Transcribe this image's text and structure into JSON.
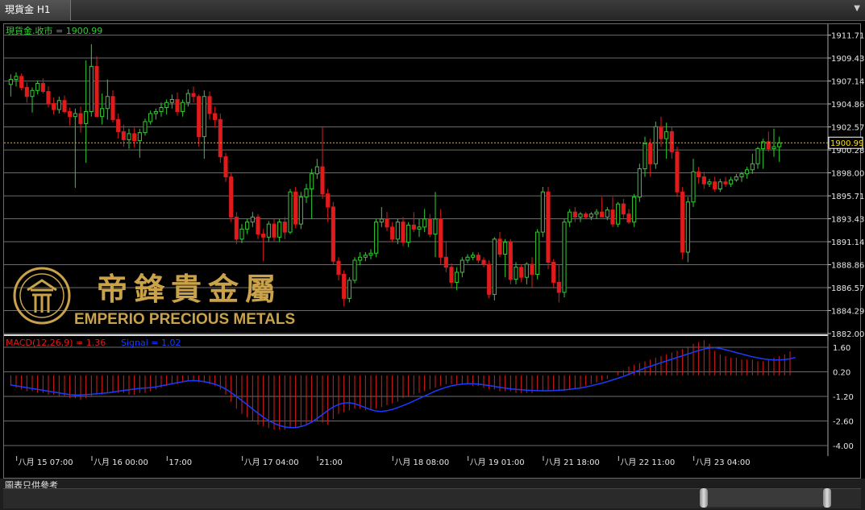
{
  "window": {
    "tab_label": "現貨金 H1",
    "menu_icon": "dropdown-triangle-icon"
  },
  "footer": {
    "label": "圖表只供參考"
  },
  "colors": {
    "up": "#33cc33",
    "down": "#e01b1b",
    "grid": "#6b6b6b",
    "price_line": "#ffaa00",
    "macd_hist": "#e01b1b",
    "signal": "#1a3cff",
    "title_text": "#33cc33",
    "macd_text": "#e01b1b",
    "logo": "#c9a24a"
  },
  "logo": {
    "chinese": "帝鋒貴金屬",
    "english": "EMPERIO PRECIOUS METALS",
    "emblem": "emperio-seal-icon"
  },
  "chart_data": [
    {
      "type": "candlestick",
      "title": "現貨金.收市 = 1900.99",
      "symbol": "現貨金",
      "timeframe": "H1",
      "last_price": 1900.99,
      "last_price_label": "1900.99",
      "ylim": [
        1882.0,
        1912.8
      ],
      "y_ticks": [
        "1911.71",
        "1909.43",
        "1907.14",
        "1904.86",
        "1902.57",
        "1900.28",
        "1898.00",
        "1895.71",
        "1893.43",
        "1891.14",
        "1888.86",
        "1886.57",
        "1884.29",
        "1882.00"
      ],
      "x_ticks": [
        "八月 15 07:00",
        "八月 16 00:00",
        "17:00",
        "八月 17 04:00",
        "21:00",
        "八月 18 08:00",
        "八月 19 01:00",
        "八月 21 18:00",
        "八月 22 11:00",
        "八月 23 04:00"
      ],
      "ohlc": [
        [
          1906.8,
          1907.8,
          1905.6,
          1907.3
        ],
        [
          1907.3,
          1908.0,
          1906.6,
          1907.6
        ],
        [
          1907.6,
          1907.9,
          1906.2,
          1906.5
        ],
        [
          1906.5,
          1907.0,
          1905.0,
          1905.6
        ],
        [
          1905.6,
          1906.5,
          1904.0,
          1906.2
        ],
        [
          1906.2,
          1907.2,
          1905.8,
          1906.9
        ],
        [
          1906.9,
          1907.4,
          1905.9,
          1906.1
        ],
        [
          1906.1,
          1906.6,
          1904.5,
          1904.9
        ],
        [
          1904.9,
          1905.5,
          1903.8,
          1904.3
        ],
        [
          1904.3,
          1905.6,
          1903.9,
          1905.2
        ],
        [
          1905.2,
          1905.7,
          1903.9,
          1904.1
        ],
        [
          1904.1,
          1904.5,
          1902.7,
          1903.6
        ],
        [
          1903.6,
          1904.4,
          1896.5,
          1903.9
        ],
        [
          1903.9,
          1904.6,
          1902.0,
          1902.9
        ],
        [
          1902.9,
          1909.2,
          1899.0,
          1904.1
        ],
        [
          1904.1,
          1910.8,
          1903.6,
          1908.6
        ],
        [
          1908.6,
          1909.6,
          1903.8,
          1903.6
        ],
        [
          1903.6,
          1905.9,
          1902.8,
          1904.4
        ],
        [
          1904.4,
          1907.3,
          1903.3,
          1905.6
        ],
        [
          1905.6,
          1906.2,
          1903.0,
          1903.3
        ],
        [
          1903.3,
          1903.9,
          1901.4,
          1902.1
        ],
        [
          1902.1,
          1902.8,
          1900.6,
          1901.3
        ],
        [
          1901.3,
          1902.4,
          1900.4,
          1901.9
        ],
        [
          1901.9,
          1902.5,
          1900.5,
          1901.2
        ],
        [
          1901.2,
          1902.4,
          1899.5,
          1902.0
        ],
        [
          1902.0,
          1903.4,
          1901.7,
          1903.1
        ],
        [
          1903.1,
          1904.2,
          1902.8,
          1903.9
        ],
        [
          1903.9,
          1904.4,
          1903.3,
          1904.1
        ],
        [
          1904.1,
          1905.0,
          1903.6,
          1904.5
        ],
        [
          1904.5,
          1905.3,
          1903.8,
          1905.0
        ],
        [
          1905.0,
          1905.8,
          1904.4,
          1905.3
        ],
        [
          1905.3,
          1906.0,
          1903.7,
          1904.1
        ],
        [
          1904.1,
          1905.3,
          1903.6,
          1905.0
        ],
        [
          1905.0,
          1906.3,
          1904.6,
          1905.9
        ],
        [
          1905.9,
          1906.6,
          1905.0,
          1905.6
        ],
        [
          1905.6,
          1905.8,
          1900.6,
          1901.6
        ],
        [
          1901.6,
          1906.2,
          1899.4,
          1905.6
        ],
        [
          1905.6,
          1906.1,
          1903.3,
          1903.9
        ],
        [
          1903.9,
          1904.6,
          1902.5,
          1903.3
        ],
        [
          1903.3,
          1903.9,
          1899.0,
          1899.6
        ],
        [
          1899.6,
          1900.0,
          1897.1,
          1897.6
        ],
        [
          1897.6,
          1898.0,
          1893.1,
          1893.6
        ],
        [
          1893.6,
          1894.1,
          1890.9,
          1891.4
        ],
        [
          1891.4,
          1892.9,
          1891.0,
          1892.4
        ],
        [
          1892.4,
          1893.4,
          1891.9,
          1893.1
        ],
        [
          1893.1,
          1894.1,
          1892.6,
          1893.6
        ],
        [
          1893.6,
          1893.9,
          1891.4,
          1891.9
        ],
        [
          1891.9,
          1892.4,
          1889.2,
          1891.6
        ],
        [
          1891.6,
          1893.2,
          1891.1,
          1892.9
        ],
        [
          1892.9,
          1893.4,
          1891.2,
          1891.6
        ],
        [
          1891.6,
          1893.4,
          1891.1,
          1893.1
        ],
        [
          1893.1,
          1893.6,
          1891.4,
          1892.1
        ],
        [
          1892.1,
          1896.4,
          1891.9,
          1896.1
        ],
        [
          1896.1,
          1896.6,
          1892.5,
          1892.9
        ],
        [
          1892.9,
          1896.1,
          1892.4,
          1895.6
        ],
        [
          1895.6,
          1896.9,
          1895.0,
          1896.4
        ],
        [
          1896.4,
          1898.4,
          1893.4,
          1897.9
        ],
        [
          1897.9,
          1899.4,
          1897.4,
          1898.6
        ],
        [
          1898.6,
          1902.6,
          1895.4,
          1895.9
        ],
        [
          1895.9,
          1896.4,
          1893.1,
          1894.6
        ],
        [
          1894.6,
          1895.1,
          1888.9,
          1889.2
        ],
        [
          1889.2,
          1889.6,
          1887.3,
          1887.9
        ],
        [
          1887.9,
          1888.3,
          1884.7,
          1885.5
        ],
        [
          1885.5,
          1887.6,
          1885.1,
          1887.3
        ],
        [
          1887.3,
          1889.6,
          1887.0,
          1889.3
        ],
        [
          1889.3,
          1890.1,
          1888.8,
          1889.6
        ],
        [
          1889.6,
          1890.1,
          1889.2,
          1889.8
        ],
        [
          1889.8,
          1890.4,
          1889.4,
          1890.0
        ],
        [
          1890.0,
          1893.4,
          1889.6,
          1893.1
        ],
        [
          1893.1,
          1894.6,
          1892.6,
          1893.4
        ],
        [
          1893.4,
          1894.1,
          1892.2,
          1892.6
        ],
        [
          1892.6,
          1893.1,
          1891.1,
          1891.4
        ],
        [
          1891.4,
          1893.4,
          1890.9,
          1893.1
        ],
        [
          1893.1,
          1893.6,
          1890.7,
          1891.1
        ],
        [
          1891.1,
          1893.1,
          1890.6,
          1892.8
        ],
        [
          1892.8,
          1894.1,
          1892.1,
          1892.4
        ],
        [
          1892.4,
          1893.4,
          1891.6,
          1892.6
        ],
        [
          1892.6,
          1894.4,
          1892.1,
          1893.4
        ],
        [
          1893.4,
          1893.9,
          1891.6,
          1891.9
        ],
        [
          1891.9,
          1896.1,
          1889.6,
          1893.4
        ],
        [
          1893.4,
          1894.4,
          1888.9,
          1889.6
        ],
        [
          1889.6,
          1891.1,
          1888.1,
          1888.6
        ],
        [
          1888.6,
          1889.0,
          1886.6,
          1887.1
        ],
        [
          1887.1,
          1888.6,
          1886.3,
          1888.1
        ],
        [
          1888.1,
          1889.6,
          1887.6,
          1889.3
        ],
        [
          1889.3,
          1889.9,
          1889.0,
          1889.6
        ],
        [
          1889.6,
          1890.1,
          1889.3,
          1889.8
        ],
        [
          1889.8,
          1890.1,
          1889.0,
          1889.3
        ],
        [
          1889.3,
          1889.6,
          1888.6,
          1888.9
        ],
        [
          1888.9,
          1889.3,
          1885.5,
          1885.9
        ],
        [
          1885.9,
          1891.6,
          1885.3,
          1891.4
        ],
        [
          1891.4,
          1892.1,
          1889.6,
          1889.9
        ],
        [
          1889.9,
          1891.4,
          1887.6,
          1891.1
        ],
        [
          1891.1,
          1891.4,
          1886.9,
          1887.4
        ],
        [
          1887.4,
          1889.1,
          1886.9,
          1888.6
        ],
        [
          1888.6,
          1888.9,
          1887.1,
          1887.6
        ],
        [
          1887.6,
          1889.1,
          1886.9,
          1888.9
        ],
        [
          1888.9,
          1889.6,
          1886.6,
          1887.9
        ],
        [
          1887.9,
          1892.4,
          1887.4,
          1892.1
        ],
        [
          1892.1,
          1896.6,
          1891.6,
          1896.1
        ],
        [
          1896.1,
          1896.6,
          1888.4,
          1889.1
        ],
        [
          1889.1,
          1889.4,
          1886.6,
          1887.1
        ],
        [
          1887.1,
          1888.9,
          1885.1,
          1886.1
        ],
        [
          1886.1,
          1893.4,
          1885.6,
          1893.1
        ],
        [
          1893.1,
          1894.4,
          1892.6,
          1894.1
        ],
        [
          1894.1,
          1894.6,
          1893.1,
          1893.6
        ],
        [
          1893.6,
          1894.1,
          1893.1,
          1893.9
        ],
        [
          1893.9,
          1894.1,
          1893.4,
          1893.6
        ],
        [
          1893.6,
          1894.1,
          1893.3,
          1893.9
        ],
        [
          1893.9,
          1894.4,
          1893.4,
          1894.1
        ],
        [
          1894.1,
          1895.6,
          1893.6,
          1893.6
        ],
        [
          1893.6,
          1894.6,
          1893.3,
          1894.3
        ],
        [
          1894.3,
          1895.6,
          1892.6,
          1892.9
        ],
        [
          1892.9,
          1895.1,
          1892.6,
          1894.9
        ],
        [
          1894.9,
          1895.4,
          1893.4,
          1893.9
        ],
        [
          1893.9,
          1894.4,
          1892.9,
          1893.1
        ],
        [
          1893.1,
          1895.9,
          1892.6,
          1895.6
        ],
        [
          1895.6,
          1898.9,
          1895.1,
          1898.4
        ],
        [
          1898.4,
          1901.6,
          1897.6,
          1900.9
        ],
        [
          1900.9,
          1901.4,
          1897.6,
          1898.9
        ],
        [
          1898.9,
          1903.1,
          1898.4,
          1902.6
        ],
        [
          1902.6,
          1903.6,
          1900.6,
          1901.4
        ],
        [
          1901.4,
          1903.0,
          1899.4,
          1902.1
        ],
        [
          1902.1,
          1902.6,
          1899.4,
          1900.1
        ],
        [
          1900.1,
          1900.6,
          1895.6,
          1896.1
        ],
        [
          1896.1,
          1896.6,
          1889.4,
          1890.1
        ],
        [
          1890.1,
          1895.6,
          1889.1,
          1895.1
        ],
        [
          1895.1,
          1899.4,
          1894.6,
          1898.1
        ],
        [
          1898.1,
          1898.6,
          1896.9,
          1897.6
        ],
        [
          1897.6,
          1898.1,
          1896.4,
          1896.9
        ],
        [
          1896.9,
          1897.4,
          1896.6,
          1897.1
        ],
        [
          1897.1,
          1897.6,
          1896.1,
          1896.4
        ],
        [
          1896.4,
          1897.4,
          1896.1,
          1897.1
        ],
        [
          1897.1,
          1897.6,
          1896.6,
          1896.9
        ],
        [
          1896.9,
          1897.6,
          1896.6,
          1897.3
        ],
        [
          1897.3,
          1897.9,
          1897.1,
          1897.6
        ],
        [
          1897.6,
          1898.1,
          1897.1,
          1897.9
        ],
        [
          1897.9,
          1898.6,
          1897.4,
          1898.3
        ],
        [
          1898.3,
          1899.9,
          1897.9,
          1898.9
        ],
        [
          1898.9,
          1900.6,
          1898.4,
          1900.4
        ],
        [
          1900.4,
          1901.4,
          1898.4,
          1901.1
        ],
        [
          1901.1,
          1902.1,
          1900.1,
          1900.4
        ],
        [
          1900.4,
          1902.4,
          1899.6,
          1900.6
        ],
        [
          1900.6,
          1901.6,
          1899.1,
          1900.99
        ]
      ]
    },
    {
      "type": "bar+line",
      "title": "MACD(12,26,9) = 1.36",
      "signal_label": "Signal = 1.02",
      "ylim": [
        -4.6,
        2.2
      ],
      "y_ticks": [
        "1.60",
        "0.20",
        "-1.20",
        "-2.60",
        "-4.00"
      ],
      "macd": [
        -0.6,
        -0.7,
        -0.8,
        -0.9,
        -0.9,
        -1.0,
        -1.0,
        -1.1,
        -1.1,
        -1.2,
        -1.2,
        -1.3,
        -1.3,
        -1.4,
        -1.3,
        -1.2,
        -1.1,
        -1.1,
        -1.0,
        -1.0,
        -1.0,
        -1.0,
        -1.1,
        -1.1,
        -1.0,
        -1.0,
        -0.9,
        -0.8,
        -0.7,
        -0.6,
        -0.5,
        -0.5,
        -0.4,
        -0.3,
        -0.3,
        -0.4,
        -0.4,
        -0.5,
        -0.6,
        -0.8,
        -1.1,
        -1.5,
        -1.9,
        -2.2,
        -2.4,
        -2.6,
        -2.8,
        -2.9,
        -3.0,
        -3.1,
        -3.1,
        -3.1,
        -3.0,
        -3.0,
        -2.9,
        -2.8,
        -2.7,
        -2.6,
        -2.7,
        -2.8,
        -2.5,
        -2.2,
        -2.1,
        -2.0,
        -1.9,
        -1.9,
        -2.0,
        -2.0,
        -1.9,
        -1.8,
        -1.7,
        -1.6,
        -1.5,
        -1.3,
        -1.2,
        -1.1,
        -1.0,
        -0.9,
        -0.8,
        -0.7,
        -0.6,
        -0.5,
        -0.5,
        -0.5,
        -0.5,
        -0.5,
        -0.6,
        -0.6,
        -0.7,
        -0.8,
        -0.8,
        -0.9,
        -0.9,
        -0.9,
        -1.0,
        -1.0,
        -1.0,
        -1.0,
        -0.9,
        -0.9,
        -0.9,
        -0.9,
        -0.9,
        -0.9,
        -0.8,
        -0.8,
        -0.7,
        -0.6,
        -0.5,
        -0.4,
        -0.3,
        -0.2,
        0.0,
        0.2,
        0.3,
        0.5,
        0.6,
        0.7,
        0.8,
        0.9,
        1.0,
        1.1,
        1.2,
        1.3,
        1.4,
        1.5,
        1.6,
        1.8,
        1.9,
        2.0,
        1.8,
        1.4,
        1.2,
        1.1,
        1.0,
        1.0,
        0.9,
        0.9,
        0.9,
        0.8,
        0.8,
        0.9,
        1.0,
        1.1,
        1.2,
        1.36
      ],
      "signal": [
        -0.55,
        -0.6,
        -0.65,
        -0.7,
        -0.75,
        -0.8,
        -0.85,
        -0.9,
        -0.95,
        -1.0,
        -1.05,
        -1.1,
        -1.12,
        -1.12,
        -1.1,
        -1.08,
        -1.05,
        -1.02,
        -1.0,
        -0.95,
        -0.9,
        -0.86,
        -0.82,
        -0.78,
        -0.74,
        -0.72,
        -0.7,
        -0.66,
        -0.6,
        -0.54,
        -0.48,
        -0.42,
        -0.36,
        -0.32,
        -0.3,
        -0.32,
        -0.36,
        -0.42,
        -0.5,
        -0.62,
        -0.78,
        -0.98,
        -1.2,
        -1.44,
        -1.68,
        -1.92,
        -2.16,
        -2.38,
        -2.58,
        -2.74,
        -2.86,
        -2.94,
        -2.98,
        -2.98,
        -2.92,
        -2.82,
        -2.66,
        -2.46,
        -2.24,
        -2.0,
        -1.8,
        -1.66,
        -1.58,
        -1.56,
        -1.62,
        -1.72,
        -1.84,
        -1.96,
        -2.04,
        -2.06,
        -2.02,
        -1.94,
        -1.84,
        -1.72,
        -1.6,
        -1.46,
        -1.32,
        -1.18,
        -1.04,
        -0.9,
        -0.78,
        -0.68,
        -0.6,
        -0.54,
        -0.5,
        -0.48,
        -0.48,
        -0.5,
        -0.54,
        -0.58,
        -0.63,
        -0.68,
        -0.73,
        -0.77,
        -0.8,
        -0.82,
        -0.84,
        -0.86,
        -0.87,
        -0.88,
        -0.88,
        -0.87,
        -0.85,
        -0.83,
        -0.8,
        -0.76,
        -0.72,
        -0.66,
        -0.6,
        -0.52,
        -0.44,
        -0.36,
        -0.26,
        -0.16,
        -0.06,
        0.06,
        0.18,
        0.3,
        0.42,
        0.52,
        0.62,
        0.72,
        0.82,
        0.92,
        1.02,
        1.12,
        1.22,
        1.32,
        1.42,
        1.5,
        1.56,
        1.58,
        1.54,
        1.46,
        1.38,
        1.3,
        1.22,
        1.14,
        1.06,
        1.0,
        0.94,
        0.9,
        0.88,
        0.88,
        0.9,
        0.94,
        1.02
      ]
    }
  ]
}
